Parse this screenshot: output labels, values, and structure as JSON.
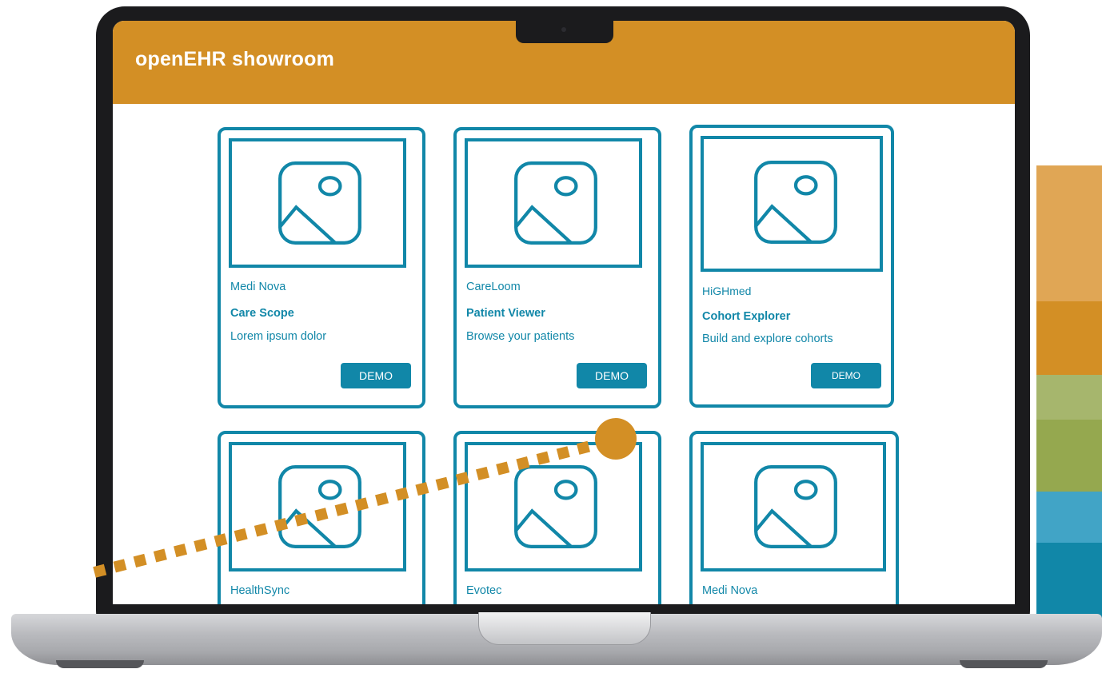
{
  "app": {
    "title": "openEHR showroom"
  },
  "colors": {
    "header": "#d38f25",
    "accent": "#1187a8",
    "stripes": [
      "#e0a655",
      "#d38f25",
      "#a6b66d",
      "#95a84f",
      "#41a4c6",
      "#1187a8"
    ]
  },
  "cards": [
    {
      "vendor": "Medi Nova",
      "name": "Care Scope",
      "description": "Lorem ipsum dolor",
      "button": "DEMO"
    },
    {
      "vendor": "CareLoom",
      "name": "Patient Viewer",
      "description": "Browse your patients",
      "button": "DEMO"
    },
    {
      "vendor": "HiGHmed",
      "name": "Cohort Explorer",
      "description": "Build and explore cohorts",
      "button": "DEMO"
    },
    {
      "vendor": "HealthSync",
      "name": "",
      "description": "",
      "button": ""
    },
    {
      "vendor": "Evotec",
      "name": "",
      "description": "",
      "button": ""
    },
    {
      "vendor": "Medi Nova",
      "name": "",
      "description": "",
      "button": ""
    }
  ],
  "icons": {
    "thumbnail": "image-placeholder-icon"
  }
}
